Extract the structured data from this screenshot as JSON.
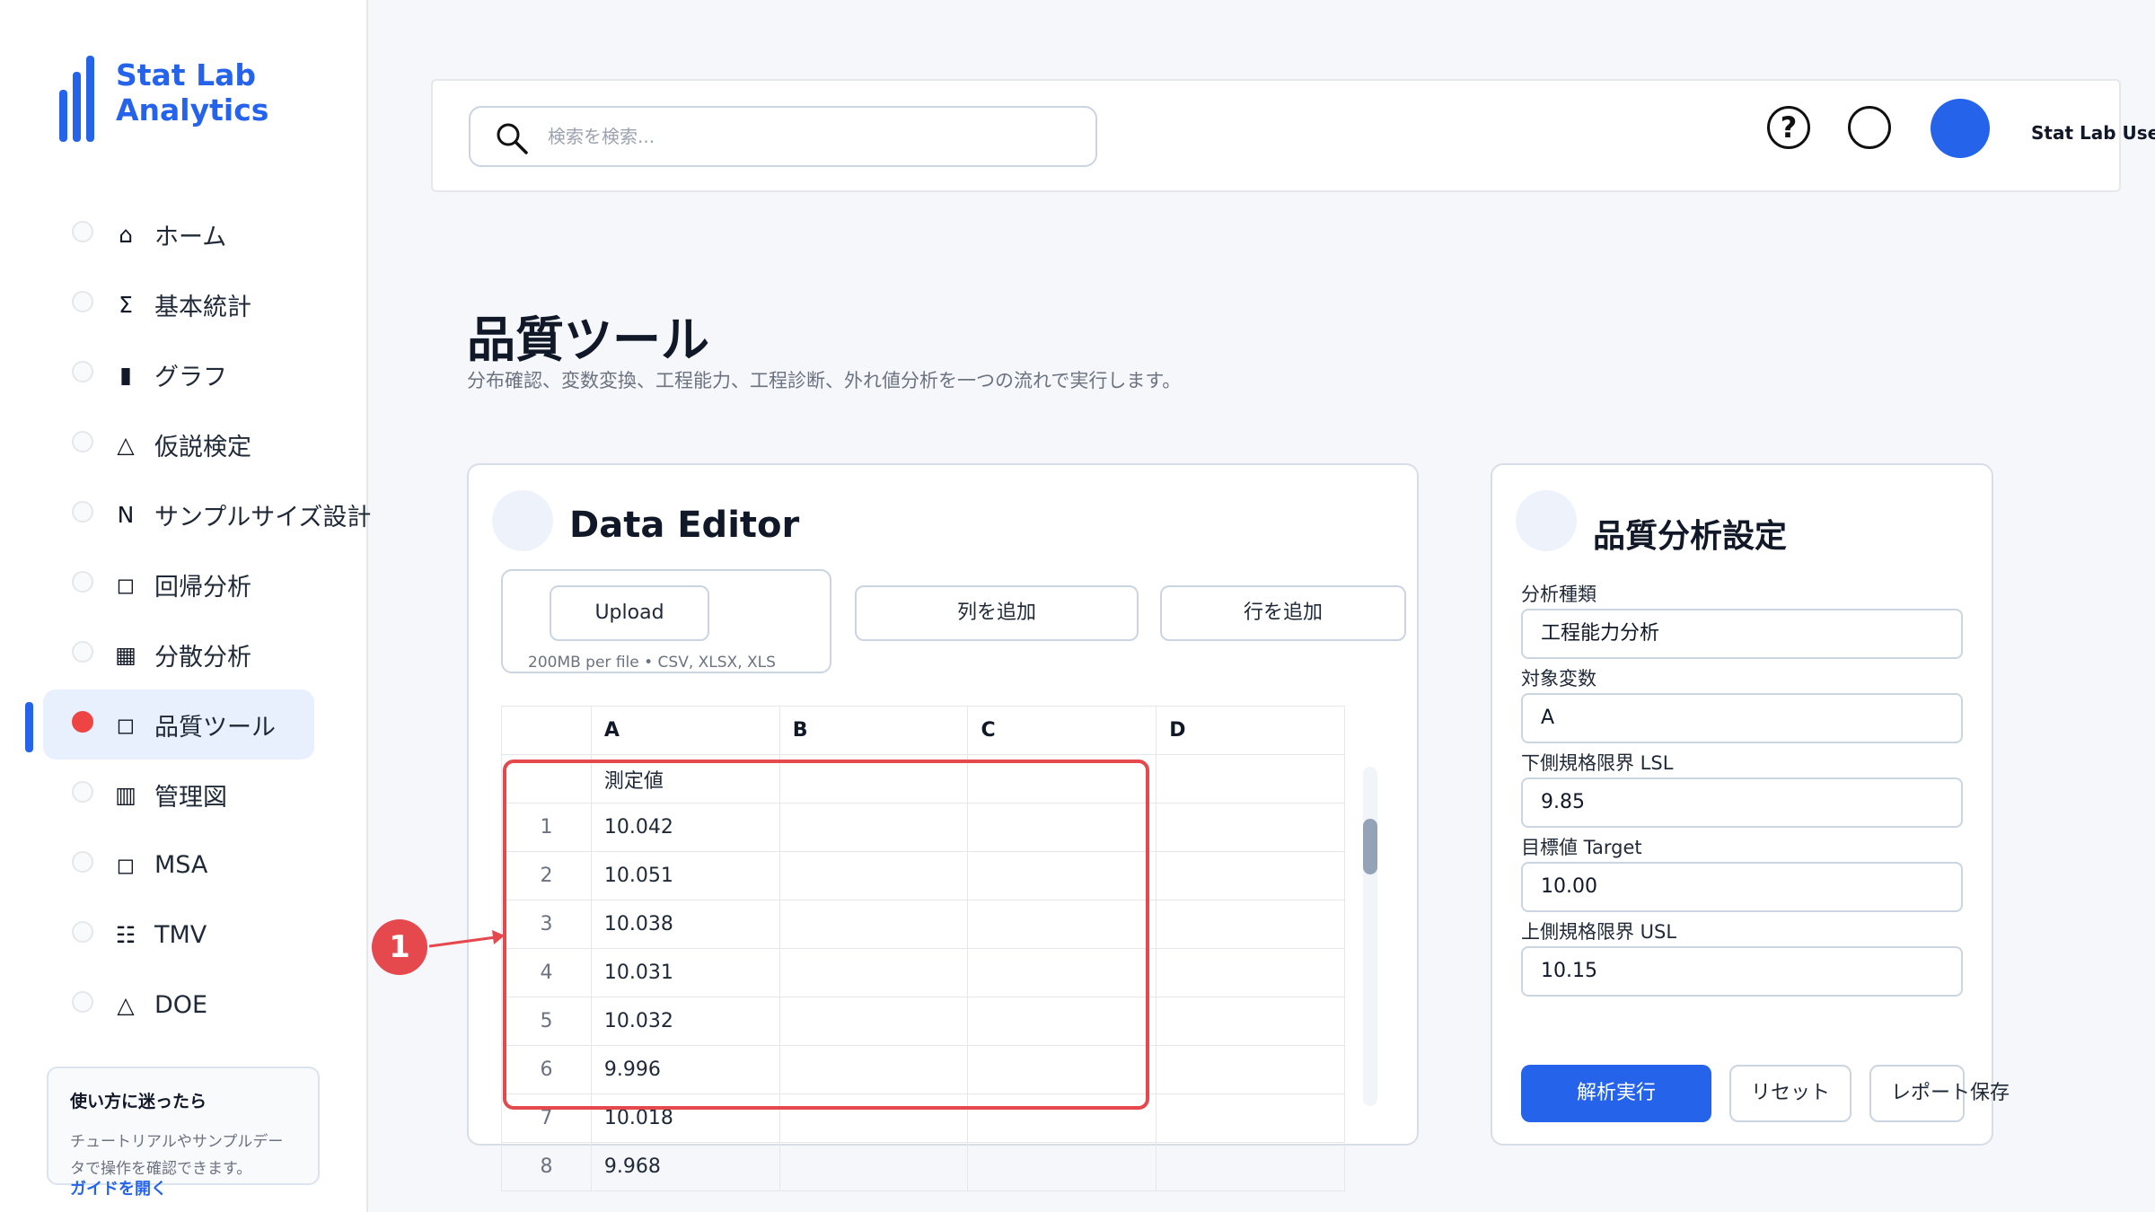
{
  "brand": {
    "title": "Stat Lab Analytics"
  },
  "sidebar": {
    "items": [
      {
        "icon": "home-icon",
        "glyph": "⌂",
        "label": "ホーム"
      },
      {
        "icon": "sigma-icon",
        "glyph": "Σ",
        "label": "基本統計"
      },
      {
        "icon": "bar-icon",
        "glyph": "▮",
        "label": "グラフ"
      },
      {
        "icon": "triangle-icon",
        "glyph": "△",
        "label": "仮説検定"
      },
      {
        "icon": "n-icon",
        "glyph": "N",
        "label": "サンプルサイズ設計"
      },
      {
        "icon": "square-icon",
        "glyph": "◻",
        "label": "回帰分析"
      },
      {
        "icon": "grid-icon",
        "glyph": "▦",
        "label": "分散分析"
      },
      {
        "icon": "square-icon",
        "glyph": "◻",
        "label": "品質ツール"
      },
      {
        "icon": "columns-icon",
        "glyph": "▥",
        "label": "管理図"
      },
      {
        "icon": "square-icon",
        "glyph": "◻",
        "label": "MSA"
      },
      {
        "icon": "list-icon",
        "glyph": "☷",
        "label": "TMV"
      },
      {
        "icon": "triangle-icon",
        "glyph": "△",
        "label": "DOE"
      }
    ],
    "active_index": 7
  },
  "help": {
    "title": "使い方に迷ったら",
    "text": "チュートリアルやサンプルデータで操作を確認できます。",
    "link": "ガイドを開く"
  },
  "header": {
    "search_placeholder": "検索を検索...",
    "help_icon": "?",
    "user_name": "Stat Lab User"
  },
  "page": {
    "title": "品質ツール",
    "subtitle": "分布確認、変数変換、工程能力、工程診断、外れ値分析を一つの流れで実行します。"
  },
  "editor": {
    "title": "Data Editor",
    "upload_label": "Upload",
    "upload_note": "200MB per file • CSV, XLSX, XLS",
    "add_column": "列を追加",
    "add_row": "行を追加",
    "columns": [
      "A",
      "B",
      "C",
      "D"
    ],
    "header_row": "測定値",
    "rows": [
      {
        "index": "1",
        "A": "10.042"
      },
      {
        "index": "2",
        "A": "10.051"
      },
      {
        "index": "3",
        "A": "10.038"
      },
      {
        "index": "4",
        "A": "10.031"
      },
      {
        "index": "5",
        "A": "10.032"
      },
      {
        "index": "6",
        "A": "9.996"
      },
      {
        "index": "7",
        "A": "10.018"
      },
      {
        "index": "8",
        "A": "9.968"
      }
    ]
  },
  "settings": {
    "title": "品質分析設定",
    "fields": [
      {
        "label": "分析種類",
        "value": "工程能力分析"
      },
      {
        "label": "対象変数",
        "value": "A"
      },
      {
        "label": "下側規格限界 LSL",
        "value": "9.85"
      },
      {
        "label": "目標値 Target",
        "value": "10.00"
      },
      {
        "label": "上側規格限界 USL",
        "value": "10.15"
      }
    ],
    "run_label": "解析実行",
    "reset_label": "リセット",
    "report_label": "レポート保存"
  },
  "annotation": {
    "badge": "1",
    "color": "#e5484d"
  }
}
